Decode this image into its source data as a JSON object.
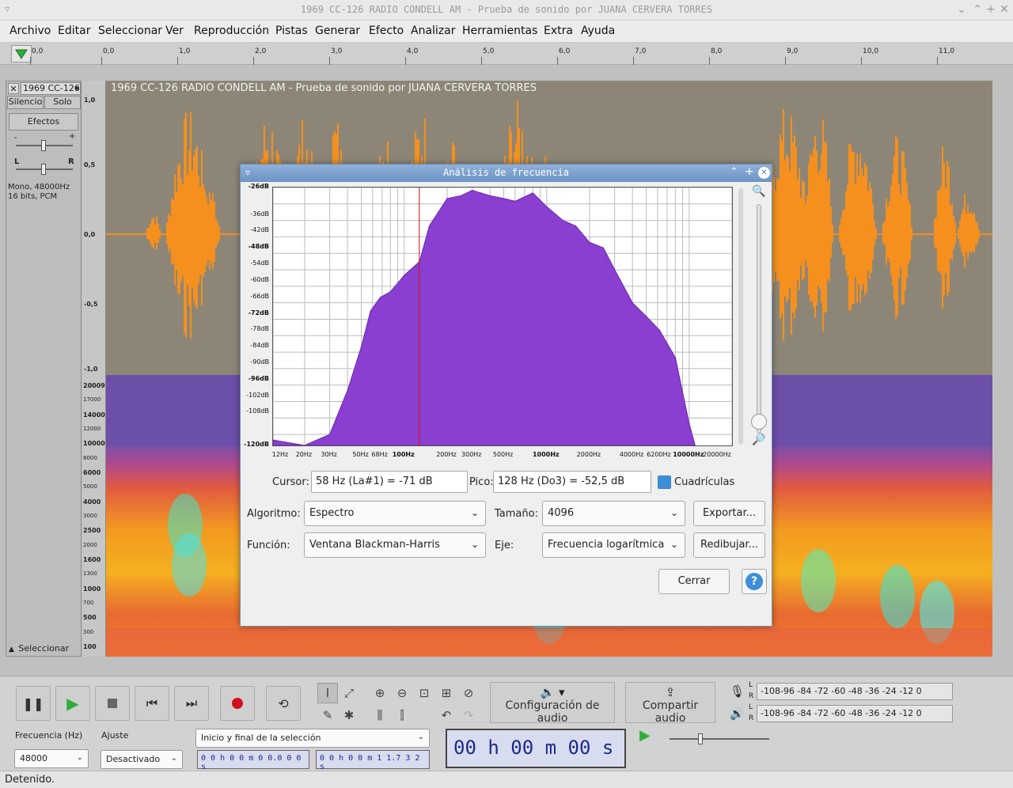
{
  "window": {
    "title": "1969 CC-126 RADIO CONDELL AM - Prueba de sonido por JUANA CERVERA TORRES"
  },
  "menu": [
    "Archivo",
    "Editar",
    "Seleccionar",
    "Ver",
    "Reproducción",
    "Pistas",
    "Generar",
    "Efecto",
    "Analizar",
    "Herramientas",
    "Extra",
    "Ayuda"
  ],
  "ruler": {
    "labels": [
      "0,0",
      "0,0",
      "1,0",
      "2,0",
      "3,0",
      "4,0",
      "5,0",
      "6,0",
      "7,0",
      "8,0",
      "9,0",
      "10,0",
      "11,0"
    ]
  },
  "track": {
    "name_short": "1969 CC-126",
    "name_full": "1969 CC-126 RADIO CONDELL AM - Prueba de sonido por JUANA CERVERA TORRES",
    "mute_label": "Silencio",
    "solo_label": "Solo",
    "effects_label": "Efectos",
    "gain_minus": "-",
    "gain_plus": "+",
    "pan_left": "L",
    "pan_right": "R",
    "info_line1": "Mono, 48000Hz",
    "info_line2": "16 bits, PCM",
    "select_label": "Seleccionar",
    "wave_scale": [
      "1,0",
      "0,5",
      "0,0",
      "-0,5",
      "-1,0"
    ],
    "spec_scale": [
      "20009",
      "17000",
      "14000",
      "12000",
      "10000",
      "8000",
      "6000",
      "5000",
      "4000",
      "3000",
      "2500",
      "2000",
      "1600",
      "1300",
      "1000",
      "700",
      "500",
      "300",
      "100"
    ]
  },
  "dialog": {
    "title": "Análisis de frecuencia",
    "y_labels": [
      "-26dB",
      "-36dB",
      "-42dB",
      "-48dB",
      "-54dB",
      "-60dB",
      "-66dB",
      "-72dB",
      "-78dB",
      "-84dB",
      "-90dB",
      "-96dB",
      "-102dB",
      "-108dB",
      "-120dB"
    ],
    "x_labels": [
      "12Hz",
      "20Hz",
      "30Hz",
      "50Hz",
      "68Hz",
      "100Hz",
      "200Hz",
      "300Hz",
      "500Hz",
      "1000Hz",
      "2000Hz",
      "4000Hz",
      "6200Hz",
      "10000Hz",
      "20000Hz"
    ],
    "cursor_label": "Cursor:",
    "cursor_value": "58 Hz (La#1) = -71 dB",
    "peak_label": "Pico:",
    "peak_value": "128 Hz (Do3) = -52,5 dB",
    "grid_label": "Cuadrículas",
    "grid_checked": true,
    "algorithm_label": "Algoritmo:",
    "algorithm_value": "Espectro",
    "size_label": "Tamaño:",
    "size_value": "4096",
    "export_label": "Exportar...",
    "function_label": "Función:",
    "function_value": "Ventana Blackman-Harris",
    "axis_label": "Eje:",
    "axis_value": "Frecuencia logarítmica",
    "redraw_label": "Redibujar...",
    "close_label": "Cerrar",
    "help_label": "?"
  },
  "chart_data": {
    "type": "area",
    "xscale": "log",
    "x": [
      12,
      20,
      30,
      40,
      50,
      58,
      68,
      80,
      100,
      128,
      150,
      200,
      250,
      300,
      400,
      500,
      600,
      800,
      1000,
      1300,
      1600,
      2000,
      2500,
      3000,
      4000,
      5000,
      6200,
      8000,
      10000,
      11000
    ],
    "y": [
      -118,
      -120,
      -116,
      -100,
      -84,
      -71,
      -66,
      -64,
      -58,
      -53,
      -40,
      -30,
      -29,
      -27,
      -29,
      -30,
      -31,
      -28,
      -33,
      -38,
      -40,
      -46,
      -48,
      -56,
      -68,
      -73,
      -78,
      -88,
      -112,
      -120
    ],
    "ylim": [
      -120,
      -26
    ],
    "xlim": [
      12,
      20000
    ],
    "cursor_hz": 58,
    "grid": true,
    "color": "#8a3fd0"
  },
  "audio_setup": {
    "label": "Configuración de audio"
  },
  "share": {
    "label": "Compartir audio"
  },
  "meter_scale": "-108-96 -84 -72 -60 -48 -36 -24 -12  0",
  "meter_lr": [
    "L",
    "R"
  ],
  "rate": {
    "label": "Frecuencia (Hz)",
    "value": "48000"
  },
  "snap": {
    "label": "Ajuste",
    "value": "Desactivado"
  },
  "selection": {
    "mode": "Inicio y final de la selección",
    "start": "0 0 h 0 0 m 0 0.0 0 0 s",
    "end": "0 0 h 0 0 m 1 1.7 3 2 s"
  },
  "time": {
    "value": "00 h 00 m 00 s"
  },
  "status": {
    "text": "Detenido."
  },
  "colors": {
    "wave_bg": "#8d8677",
    "wave": "#f5901e",
    "dialog_title": "#6e94c6",
    "spectrum": "#8a3fd0"
  }
}
